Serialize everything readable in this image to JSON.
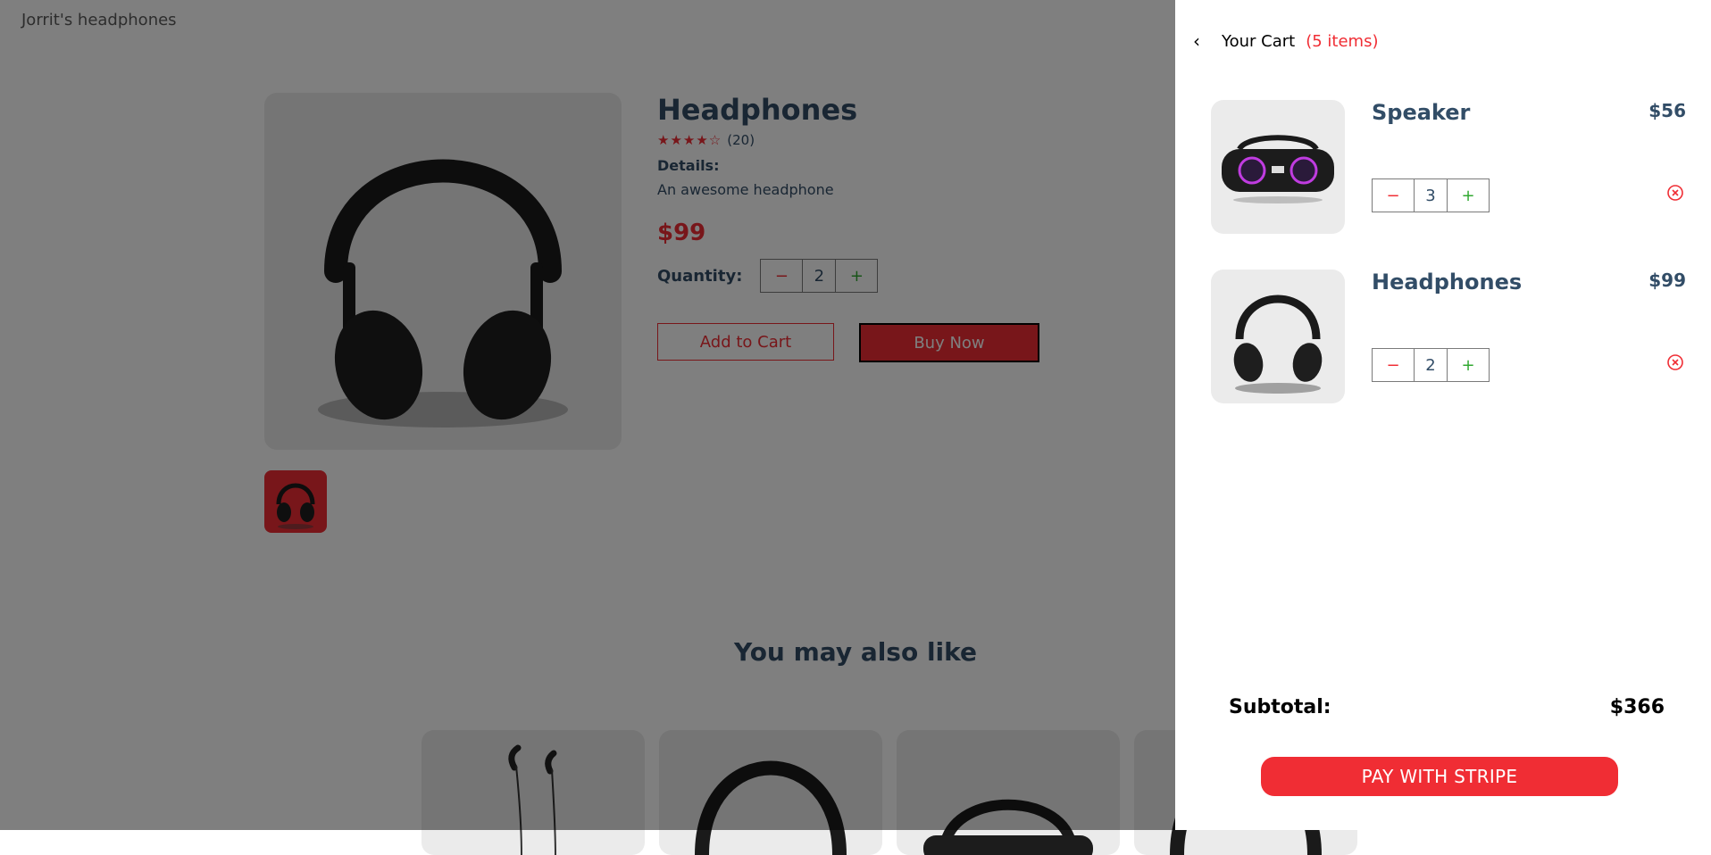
{
  "brand": {
    "logo_text": "Jorrit's headphones"
  },
  "product": {
    "title": "Headphones",
    "rating_stars": "★★★★☆",
    "rating_count": "(20)",
    "details_label": "Details:",
    "details_text": "An awesome headphone",
    "price": "$99",
    "quantity_label": "Quantity:",
    "quantity": "2",
    "minus_glyph": "−",
    "plus_glyph": "+",
    "add_to_cart_label": "Add to Cart",
    "buy_now_label": "Buy Now",
    "thumbnail_icon": "headphones-icon"
  },
  "related": {
    "heading": "You may also like",
    "items": [
      {
        "icon": "earphones-icon"
      },
      {
        "icon": "headphones-icon"
      },
      {
        "icon": "speaker-icon"
      },
      {
        "icon": "headphones-icon"
      }
    ]
  },
  "cart": {
    "back_glyph": "‹",
    "title": "Your Cart",
    "count_label": "(5 items)",
    "items": [
      {
        "name": "Speaker",
        "price": "$56",
        "quantity": "3",
        "icon": "speaker-icon"
      },
      {
        "name": "Headphones",
        "price": "$99",
        "quantity": "2",
        "icon": "headphones-icon"
      }
    ],
    "minus_glyph": "−",
    "plus_glyph": "+",
    "subtotal_label": "Subtotal:",
    "subtotal_value": "$366",
    "pay_button_label": "PAY WITH STRIPE"
  },
  "colors": {
    "accent": "#f02d34",
    "heading_text": "#324d67",
    "plus_green": "#31a831",
    "image_bg": "#ebebeb",
    "overlay": "rgba(0,0,0,0.5)"
  }
}
